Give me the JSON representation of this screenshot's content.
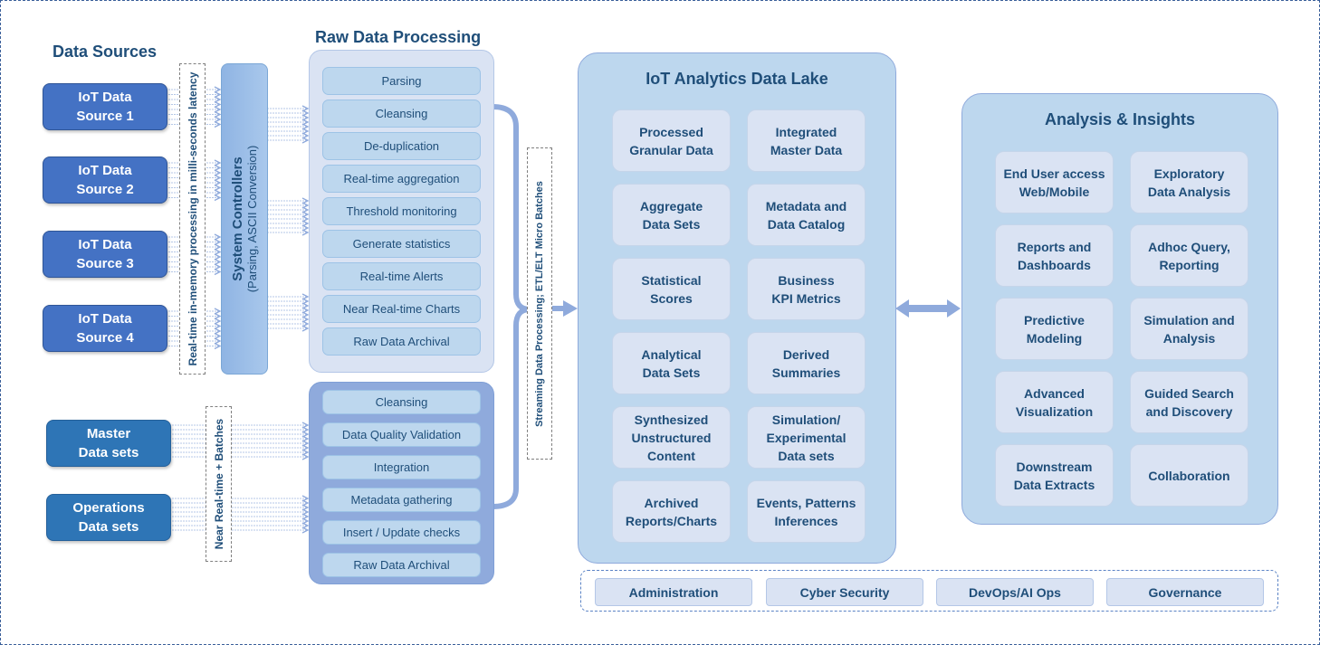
{
  "titles": {
    "data_sources": "Data Sources",
    "raw_processing": "Raw Data Processing"
  },
  "sources": {
    "iot": [
      {
        "line1": "IoT Data",
        "line2": "Source 1"
      },
      {
        "line1": "IoT Data",
        "line2": "Source 2"
      },
      {
        "line1": "IoT Data",
        "line2": "Source 3"
      },
      {
        "line1": "IoT Data",
        "line2": "Source 4"
      }
    ],
    "batch": [
      {
        "line1": "Master",
        "line2": "Data sets"
      },
      {
        "line1": "Operations",
        "line2": "Data sets"
      }
    ]
  },
  "labels": {
    "realtime_latency": "Real-time in-memory processing in milli-seconds latency",
    "near_realtime": "Near Real-time + Batches",
    "streaming": "Streaming Data Processing; ETL/ELT Micro Batches"
  },
  "controllers": {
    "title": "System Controllers",
    "subtitle": "(Parsing, ASCII Conversion)"
  },
  "raw_steps": [
    "Parsing",
    "Cleansing",
    "De-duplication",
    "Real-time aggregation",
    "Threshold monitoring",
    "Generate statistics",
    "Real-time Alerts",
    "Near Real-time Charts",
    "Raw Data Archival"
  ],
  "batch_steps": [
    "Cleansing",
    "Data Quality Validation",
    "Integration",
    "Metadata gathering",
    "Insert / Update checks",
    "Raw Data Archival"
  ],
  "data_lake": {
    "title": "IoT Analytics Data Lake",
    "tiles": [
      [
        "Processed",
        "Granular Data"
      ],
      [
        "Integrated",
        "Master Data"
      ],
      [
        "Aggregate",
        "Data Sets"
      ],
      [
        "Metadata and",
        "Data Catalog"
      ],
      [
        "Statistical",
        "Scores"
      ],
      [
        "Business",
        "KPI Metrics"
      ],
      [
        "Analytical",
        "Data Sets"
      ],
      [
        "Derived",
        "Summaries"
      ],
      [
        "Synthesized",
        "Unstructured",
        "Content"
      ],
      [
        "Simulation/",
        "Experimental",
        "Data sets"
      ],
      [
        "Archived",
        "Reports/Charts"
      ],
      [
        "Events, Patterns",
        "Inferences"
      ]
    ]
  },
  "insights": {
    "title": "Analysis & Insights",
    "tiles": [
      [
        "End User access",
        "Web/Mobile"
      ],
      [
        "Exploratory",
        "Data Analysis"
      ],
      [
        "Reports and",
        "Dashboards"
      ],
      [
        "Adhoc Query,",
        "Reporting"
      ],
      [
        "Predictive",
        "Modeling"
      ],
      [
        "Simulation and",
        "Analysis"
      ],
      [
        "Advanced",
        "Visualization"
      ],
      [
        "Guided Search",
        "and Discovery"
      ],
      [
        "Downstream",
        "Data Extracts"
      ],
      [
        "Collaboration"
      ]
    ]
  },
  "governance": [
    "Administration",
    "Cyber Security",
    "DevOps/AI Ops",
    "Governance"
  ],
  "colors": {
    "iot_source": "#4472c4",
    "batch_source": "#2e75b6",
    "title_text": "#1f4e79",
    "panel_light": "#dae3f3",
    "panel_mid": "#bdd7ee",
    "connector": "#8faadc"
  }
}
